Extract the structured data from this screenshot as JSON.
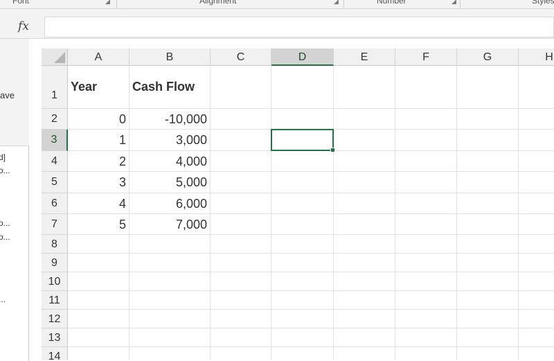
{
  "ribbon": {
    "groups": [
      "Font",
      "Alignment",
      "Number",
      "Styles"
    ]
  },
  "formula_bar": {
    "fx_label": "fx",
    "value": ""
  },
  "side_pane": {
    "save_label": "ave",
    "items": [
      "d]",
      "o...",
      "o...",
      "o...",
      "..."
    ]
  },
  "sheet": {
    "columns": [
      "A",
      "B",
      "C",
      "D",
      "E",
      "F",
      "G",
      "H"
    ],
    "rows": [
      "1",
      "2",
      "3",
      "4",
      "5",
      "6",
      "7",
      "8",
      "9",
      "10",
      "11",
      "12",
      "13",
      "14"
    ],
    "active_column": "D",
    "active_row": "3",
    "selected_cell": "D3",
    "cells": {
      "A1": "Year",
      "B1": "Cash Flow",
      "A2": "0",
      "B2": "-10,000",
      "A3": "1",
      "B3": "3,000",
      "A4": "2",
      "B4": "4,000",
      "A5": "3",
      "B5": "5,000",
      "A6": "4",
      "B6": "6,000",
      "A7": "5",
      "B7": "7,000"
    }
  },
  "colors": {
    "accent": "#217346",
    "gridline": "#e1e1e1",
    "header_bg": "#f0f0f0"
  }
}
